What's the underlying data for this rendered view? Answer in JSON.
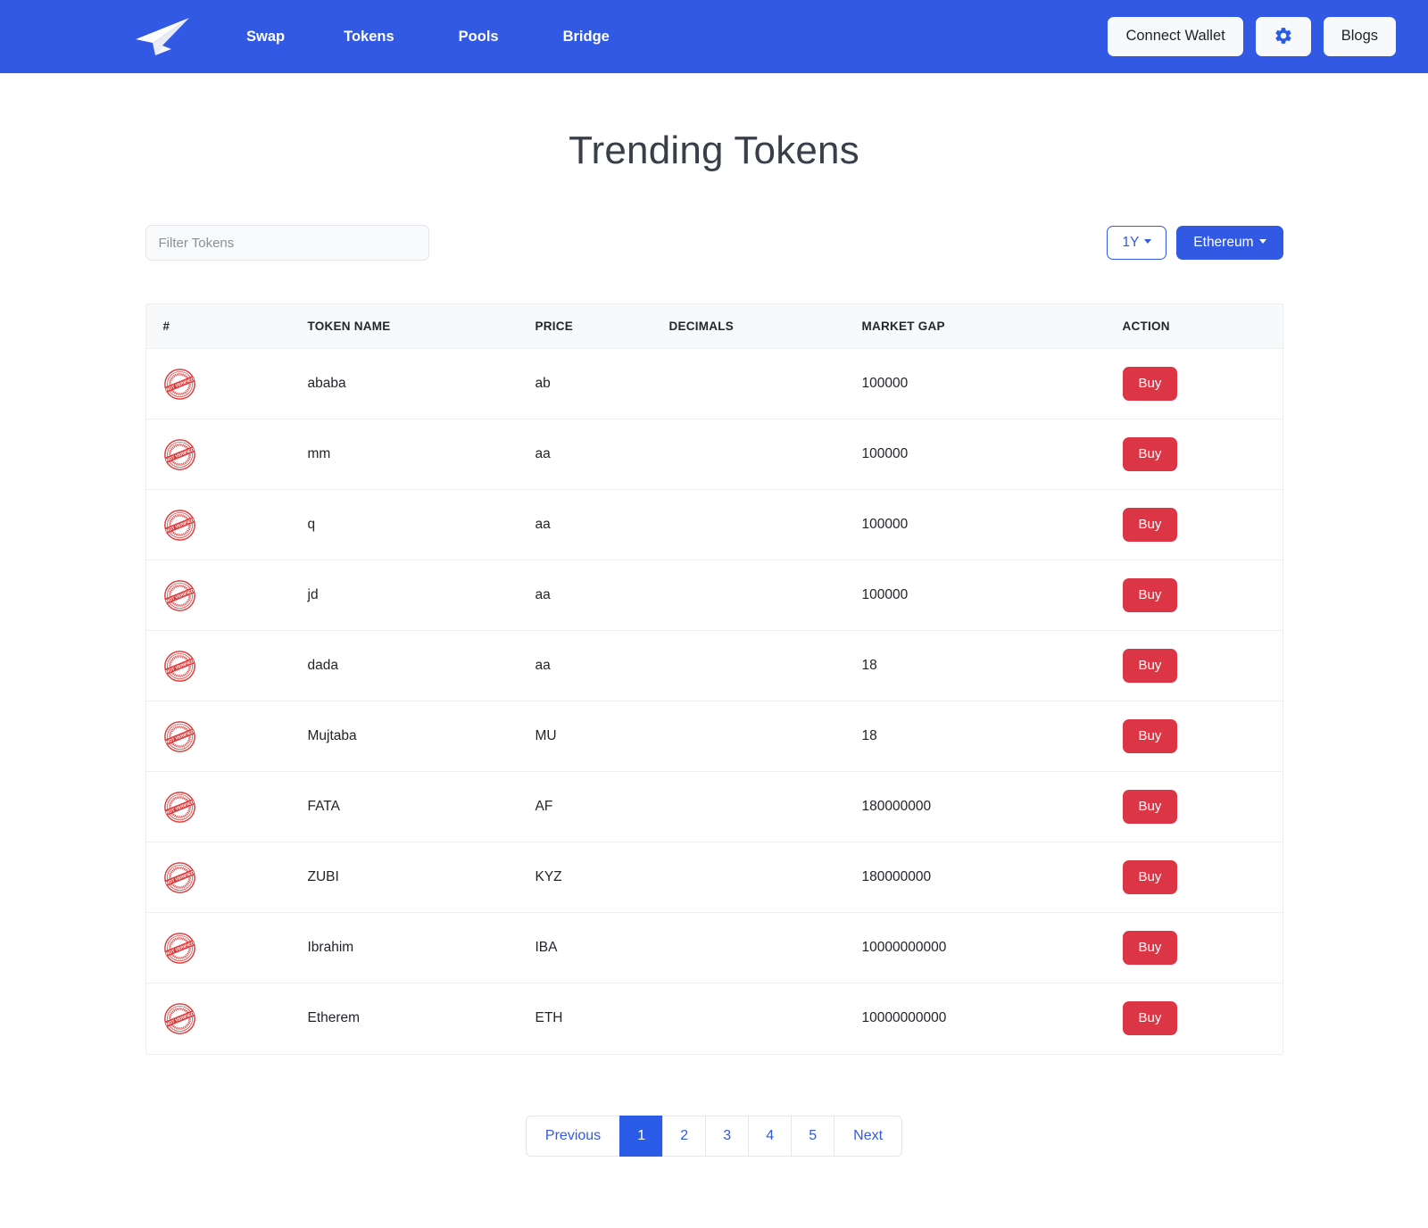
{
  "navbar": {
    "logo_icon": "paper-plane-icon",
    "links": [
      {
        "label": "Swap"
      },
      {
        "label": "Tokens"
      },
      {
        "label": "Pools"
      },
      {
        "label": "Bridge"
      }
    ],
    "connect_wallet_label": "Connect Wallet",
    "settings_icon": "gear-icon",
    "blogs_label": "Blogs",
    "background_color": "#3159e3"
  },
  "page": {
    "title": "Trending Tokens"
  },
  "controls": {
    "filter_placeholder": "Filter Tokens",
    "filter_value": "",
    "timeframe_label": "1Y",
    "network_label": "Ethereum"
  },
  "table": {
    "headers": [
      "#",
      "TOKEN NAME",
      "PRICE",
      "DECIMALS",
      "MARKET GAP",
      "ACTION"
    ],
    "badge_icon": "not-verified-stamp-icon",
    "badge_text": "NOT VERIFIED",
    "action_label": "Buy",
    "rows": [
      {
        "name": "ababa",
        "price": "ab",
        "decimals": "",
        "market_gap": "100000"
      },
      {
        "name": "mm",
        "price": "aa",
        "decimals": "",
        "market_gap": "100000"
      },
      {
        "name": "q",
        "price": "aa",
        "decimals": "",
        "market_gap": "100000"
      },
      {
        "name": "jd",
        "price": "aa",
        "decimals": "",
        "market_gap": "100000"
      },
      {
        "name": "dada",
        "price": "aa",
        "decimals": "",
        "market_gap": "18"
      },
      {
        "name": "Mujtaba",
        "price": "MU",
        "decimals": "",
        "market_gap": "18"
      },
      {
        "name": "FATA",
        "price": "AF",
        "decimals": "",
        "market_gap": "180000000"
      },
      {
        "name": "ZUBI",
        "price": "KYZ",
        "decimals": "",
        "market_gap": "180000000"
      },
      {
        "name": "Ibrahim",
        "price": "IBA",
        "decimals": "",
        "market_gap": "10000000000"
      },
      {
        "name": "Etherem",
        "price": "ETH",
        "decimals": "",
        "market_gap": "10000000000"
      }
    ]
  },
  "pagination": {
    "previous_label": "Previous",
    "next_label": "Next",
    "pages": [
      "1",
      "2",
      "3",
      "4",
      "5"
    ],
    "active_page": "1"
  },
  "colors": {
    "primary": "#3159e3",
    "danger": "#dc3545",
    "header_bg": "#f8f9fa"
  }
}
